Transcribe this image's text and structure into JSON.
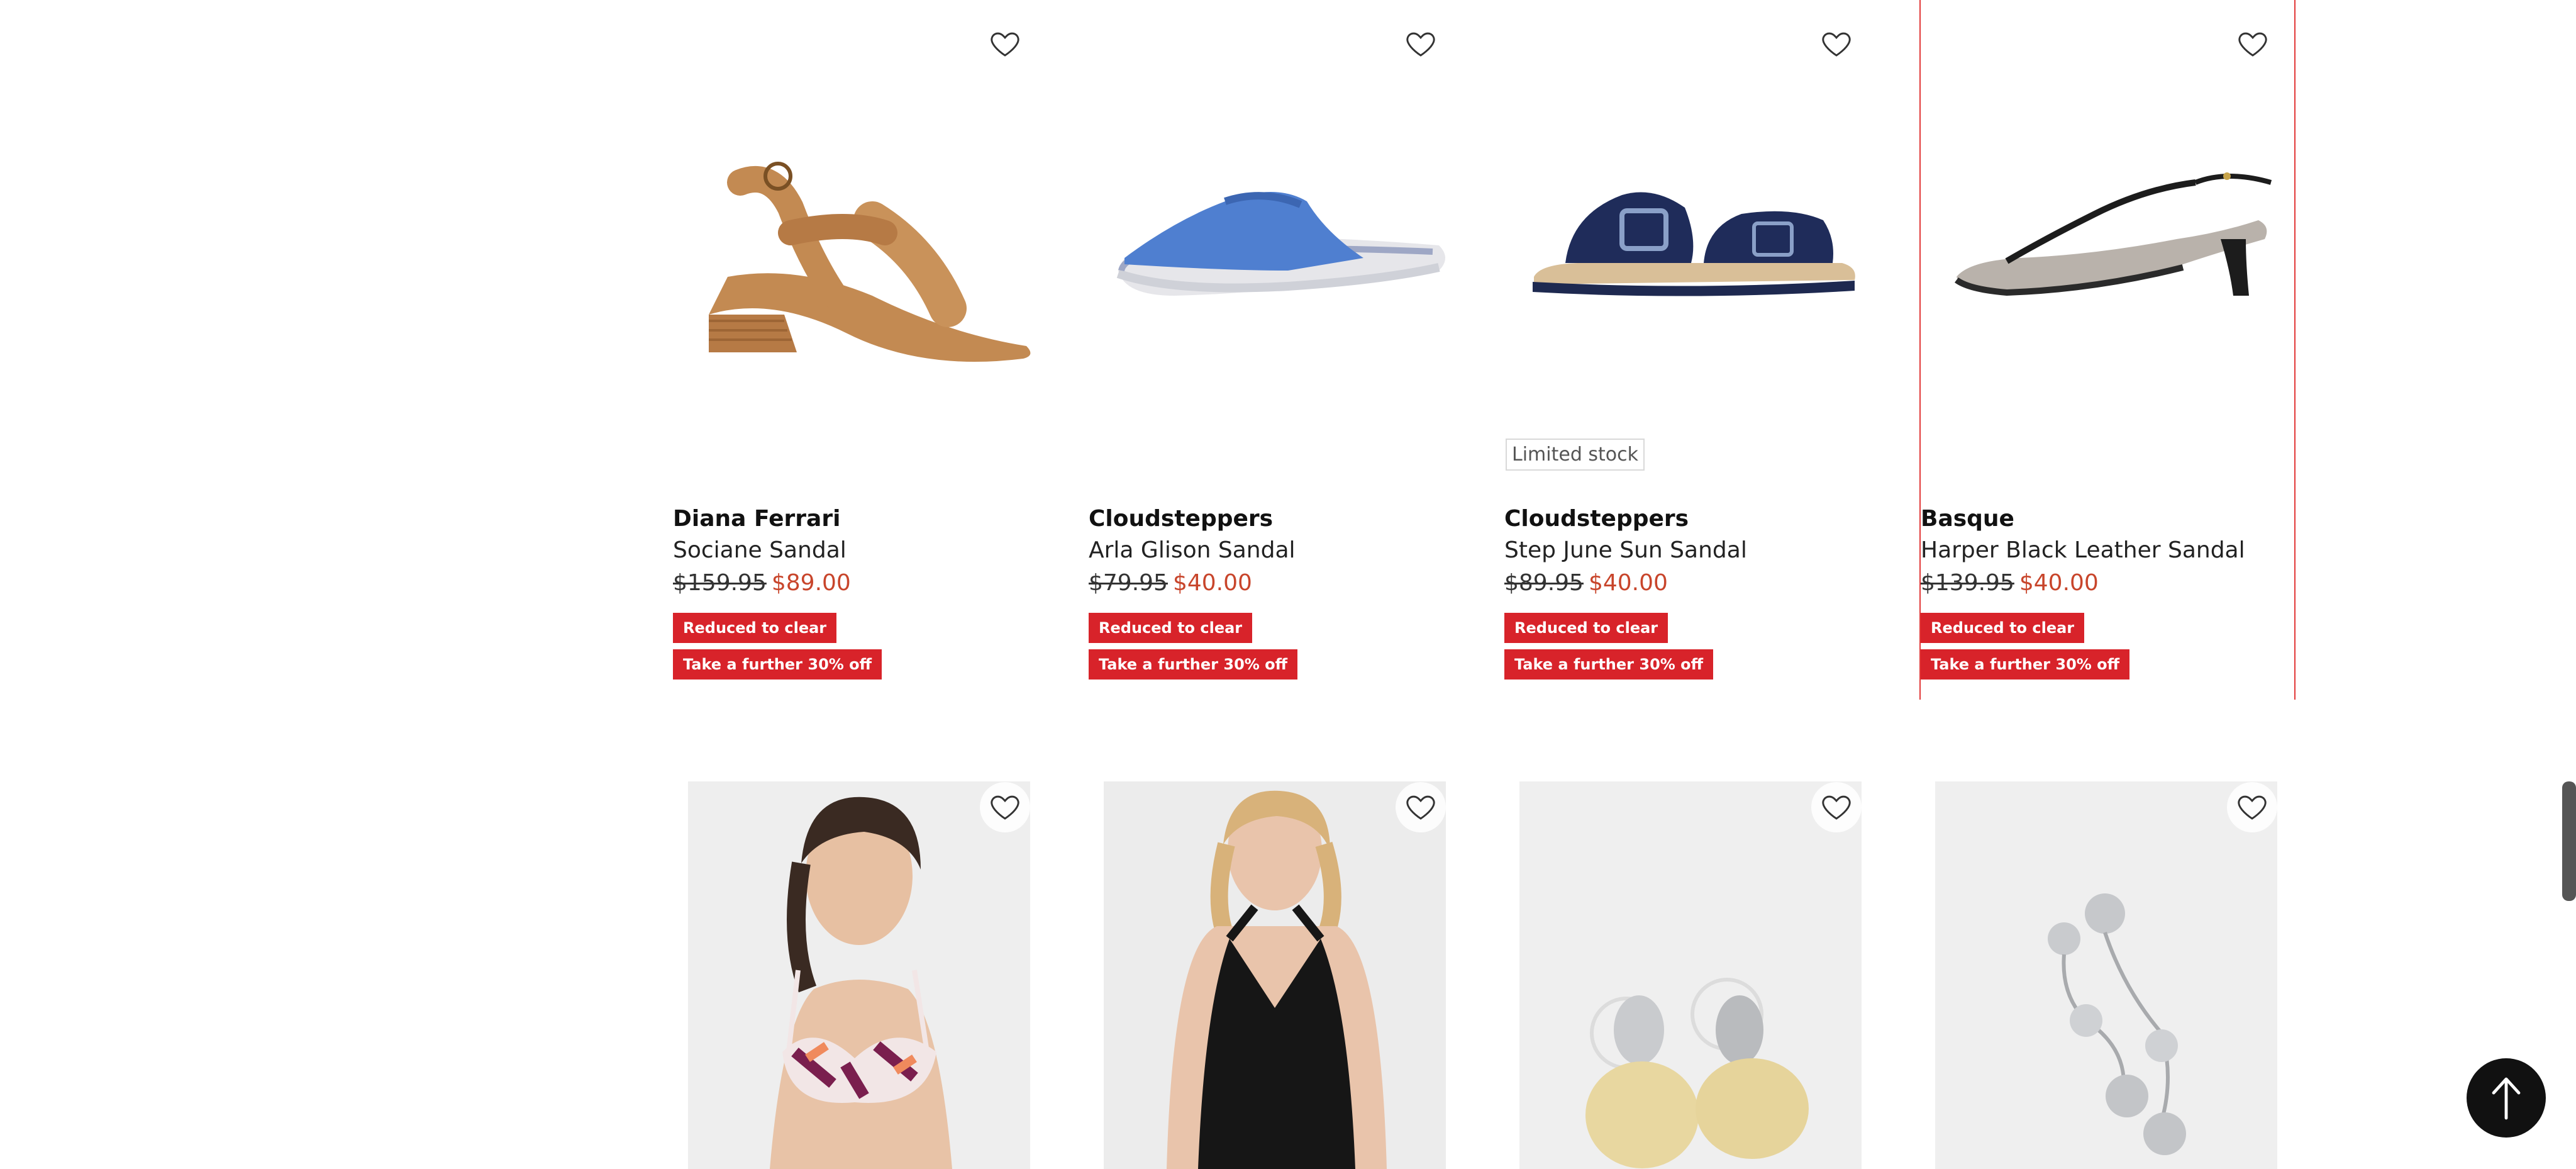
{
  "products": [
    {
      "brand": "Diana Ferrari",
      "name": "Sociane Sandal",
      "was_price": "$159.95",
      "now_price": "$89.00",
      "badges": [
        "Reduced to clear",
        "Take a further 30% off"
      ],
      "stock": ""
    },
    {
      "brand": "Cloudsteppers",
      "name": "Arla Glison Sandal",
      "was_price": "$79.95",
      "now_price": "$40.00",
      "badges": [
        "Reduced to clear",
        "Take a further 30% off"
      ],
      "stock": ""
    },
    {
      "brand": "Cloudsteppers",
      "name": "Step June Sun Sandal",
      "was_price": "$89.95",
      "now_price": "$40.00",
      "badges": [
        "Reduced to clear",
        "Take a further 30% off"
      ],
      "stock": "Limited stock"
    },
    {
      "brand": "Basque",
      "name": "Harper Black Leather Sandal",
      "was_price": "$139.95",
      "now_price": "$40.00",
      "badges": [
        "Reduced to clear",
        "Take a further 30% off"
      ],
      "stock": ""
    }
  ],
  "icons": {
    "wishlist": "heart-outline-icon",
    "back_to_top": "arrow-up-icon"
  },
  "colors": {
    "sale_badge": "#d8232a",
    "sale_price": "#c8452b",
    "hover_outline": "#e23a3a"
  }
}
